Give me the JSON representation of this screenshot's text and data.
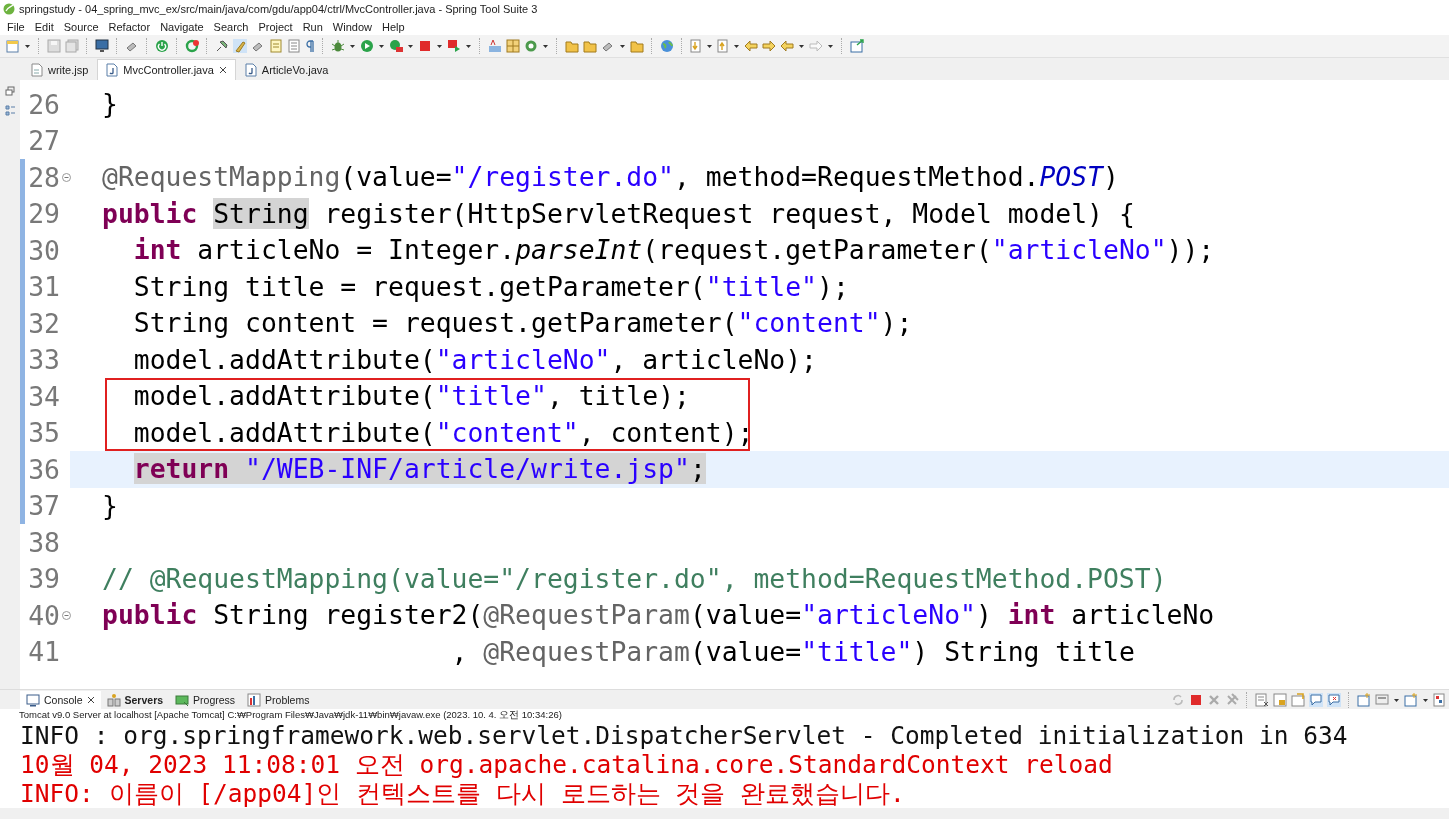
{
  "window": {
    "title": "springstudy - 04_spring_mvc_ex/src/main/java/com/gdu/app04/ctrl/MvcController.java - Spring Tool Suite 3"
  },
  "menu": [
    "File",
    "Edit",
    "Source",
    "Refactor",
    "Navigate",
    "Search",
    "Project",
    "Run",
    "Window",
    "Help"
  ],
  "editor_tabs": [
    {
      "label": "write.jsp",
      "kind": "jsp",
      "selected": false,
      "closable": false
    },
    {
      "label": "MvcController.java",
      "kind": "java",
      "selected": true,
      "closable": true
    },
    {
      "label": "ArticleVo.java",
      "kind": "java",
      "selected": false,
      "closable": false
    }
  ],
  "editor": {
    "lines": [
      {
        "number": "26",
        "foldable": false,
        "changed": false,
        "current": false,
        "boxed": false,
        "tokens": [
          {
            "kind": "plain",
            "text": "}",
            "highlight": false
          }
        ]
      },
      {
        "number": "27",
        "foldable": false,
        "changed": false,
        "current": false,
        "boxed": false
      },
      {
        "number": "28",
        "foldable": true,
        "changed": true,
        "current": false,
        "boxed": false,
        "tokens": [
          {
            "kind": "annotation",
            "text": "@RequestMapping",
            "highlight": false
          },
          {
            "kind": "plain",
            "text": "(value=",
            "highlight": false
          },
          {
            "kind": "string",
            "text": "\"/register.do\"",
            "highlight": false
          },
          {
            "kind": "plain",
            "text": ", method=RequestMethod.",
            "highlight": false
          },
          {
            "kind": "constant",
            "text": "POST",
            "highlight": false
          },
          {
            "kind": "plain",
            "text": ")",
            "highlight": false
          }
        ]
      },
      {
        "number": "29",
        "foldable": false,
        "changed": true,
        "current": false,
        "boxed": false,
        "tokens": [
          {
            "kind": "keyword",
            "text": "public ",
            "highlight": false
          },
          {
            "kind": "plain",
            "text": "String",
            "highlight": true
          },
          {
            "kind": "plain",
            "text": " register(HttpServletRequest request, Model model) {",
            "highlight": false
          }
        ]
      },
      {
        "number": "30",
        "foldable": false,
        "changed": true,
        "current": false,
        "boxed": false,
        "tokens": [
          {
            "kind": "keyword",
            "text": "  int",
            "highlight": false
          },
          {
            "kind": "plain",
            "text": " articleNo = Integer.",
            "highlight": false
          },
          {
            "kind": "static",
            "text": "parseInt",
            "highlight": false
          },
          {
            "kind": "plain",
            "text": "(request.getParameter(",
            "highlight": false
          },
          {
            "kind": "string",
            "text": "\"articleNo\"",
            "highlight": false
          },
          {
            "kind": "plain",
            "text": "));",
            "highlight": false
          }
        ]
      },
      {
        "number": "31",
        "foldable": false,
        "changed": true,
        "current": false,
        "boxed": false,
        "tokens": [
          {
            "kind": "plain",
            "text": "  String title = request.getParameter(",
            "highlight": false
          },
          {
            "kind": "string",
            "text": "\"title\"",
            "highlight": false
          },
          {
            "kind": "plain",
            "text": ");",
            "highlight": false
          }
        ]
      },
      {
        "number": "32",
        "foldable": false,
        "changed": true,
        "current": false,
        "boxed": false,
        "tokens": [
          {
            "kind": "plain",
            "text": "  String content = request.getParameter(",
            "highlight": false
          },
          {
            "kind": "string",
            "text": "\"content\"",
            "highlight": false
          },
          {
            "kind": "plain",
            "text": ");",
            "highlight": false
          }
        ]
      },
      {
        "number": "33",
        "foldable": false,
        "changed": true,
        "current": false,
        "boxed": false,
        "tokens": [
          {
            "kind": "plain",
            "text": "  model.addAttribute(",
            "highlight": false
          },
          {
            "kind": "string",
            "text": "\"articleNo\"",
            "highlight": false
          },
          {
            "kind": "plain",
            "text": ", articleNo);",
            "highlight": false
          }
        ]
      },
      {
        "number": "34",
        "foldable": false,
        "changed": true,
        "current": false,
        "boxed": true,
        "tokens": [
          {
            "kind": "plain",
            "text": "  model.addAttribute(",
            "highlight": false
          },
          {
            "kind": "string",
            "text": "\"title\"",
            "highlight": false
          },
          {
            "kind": "plain",
            "text": ", title);",
            "highlight": false
          }
        ]
      },
      {
        "number": "35",
        "foldable": false,
        "changed": true,
        "current": false,
        "boxed": true,
        "tokens": [
          {
            "kind": "plain",
            "text": "  model.addAttribute(",
            "highlight": false
          },
          {
            "kind": "string",
            "text": "\"content\"",
            "highlight": false
          },
          {
            "kind": "plain",
            "text": ", content);",
            "highlight": false
          }
        ]
      },
      {
        "number": "36",
        "foldable": false,
        "changed": true,
        "current": true,
        "boxed": false,
        "tokens": [
          {
            "kind": "keyword",
            "text": "  return",
            "highlight": true
          },
          {
            "kind": "string",
            "text": " \"/WEB-INF/article/write.jsp\"",
            "highlight": true
          },
          {
            "kind": "plain",
            "text": ";",
            "highlight": true
          }
        ]
      },
      {
        "number": "37",
        "foldable": false,
        "changed": true,
        "current": false,
        "boxed": false,
        "tokens": [
          {
            "kind": "plain",
            "text": "}",
            "highlight": false
          }
        ]
      },
      {
        "number": "38",
        "foldable": false,
        "changed": false,
        "current": false,
        "boxed": false
      },
      {
        "number": "39",
        "foldable": false,
        "changed": false,
        "current": false,
        "boxed": false,
        "tokens": [
          {
            "kind": "comment",
            "text": "// @RequestMapping(value=\"/register.do\", method=RequestMethod.POST)",
            "highlight": false
          }
        ]
      },
      {
        "number": "40",
        "foldable": true,
        "changed": false,
        "current": false,
        "boxed": false,
        "tokens": [
          {
            "kind": "keyword",
            "text": "public",
            "highlight": false
          },
          {
            "kind": "plain",
            "text": " String register2(",
            "highlight": false
          },
          {
            "kind": "annotation",
            "text": "@RequestParam",
            "highlight": false
          },
          {
            "kind": "plain",
            "text": "(value=",
            "highlight": false
          },
          {
            "kind": "string",
            "text": "\"articleNo\"",
            "highlight": false
          },
          {
            "kind": "plain",
            "text": ") ",
            "highlight": false
          },
          {
            "kind": "keyword",
            "text": "int",
            "highlight": false
          },
          {
            "kind": "plain",
            "text": " articleNo",
            "highlight": false
          }
        ]
      },
      {
        "number": "41",
        "foldable": false,
        "changed": false,
        "current": false,
        "boxed": false,
        "tokens": [
          {
            "kind": "plain",
            "text": "                      , ",
            "highlight": false
          },
          {
            "kind": "annotation",
            "text": "@RequestParam",
            "highlight": false
          },
          {
            "kind": "plain",
            "text": "(value=",
            "highlight": false
          },
          {
            "kind": "string",
            "text": "\"title\"",
            "highlight": false
          },
          {
            "kind": "plain",
            "text": ") String title",
            "highlight": false
          }
        ]
      }
    ]
  },
  "views": [
    {
      "label": "Console",
      "kind": "console",
      "selected": true,
      "emphasized": false,
      "closable": true
    },
    {
      "label": "Servers",
      "kind": "servers",
      "selected": false,
      "emphasized": true,
      "closable": false
    },
    {
      "label": "Progress",
      "kind": "progress",
      "selected": false,
      "emphasized": false,
      "closable": false
    },
    {
      "label": "Problems",
      "kind": "problems",
      "selected": false,
      "emphasized": false,
      "closable": false
    }
  ],
  "console": {
    "process": "Tomcat v9.0 Server at localhost [Apache Tomcat] C:₩Program Files₩Java₩jdk-11₩bin₩javaw.exe  (2023. 10. 4. 오전 10:34:26)",
    "lines": [
      {
        "kind": "info",
        "text": "INFO : org.springframework.web.servlet.DispatcherServlet - Completed initialization in 634"
      },
      {
        "kind": "error",
        "text": "10월 04, 2023 11:08:01 오전 org.apache.catalina.core.StandardContext reload"
      },
      {
        "kind": "error",
        "text": "INFO: 이름이 [/app04]인 컨텍스트를 다시 로드하는 것을 완료했습니다."
      }
    ]
  }
}
